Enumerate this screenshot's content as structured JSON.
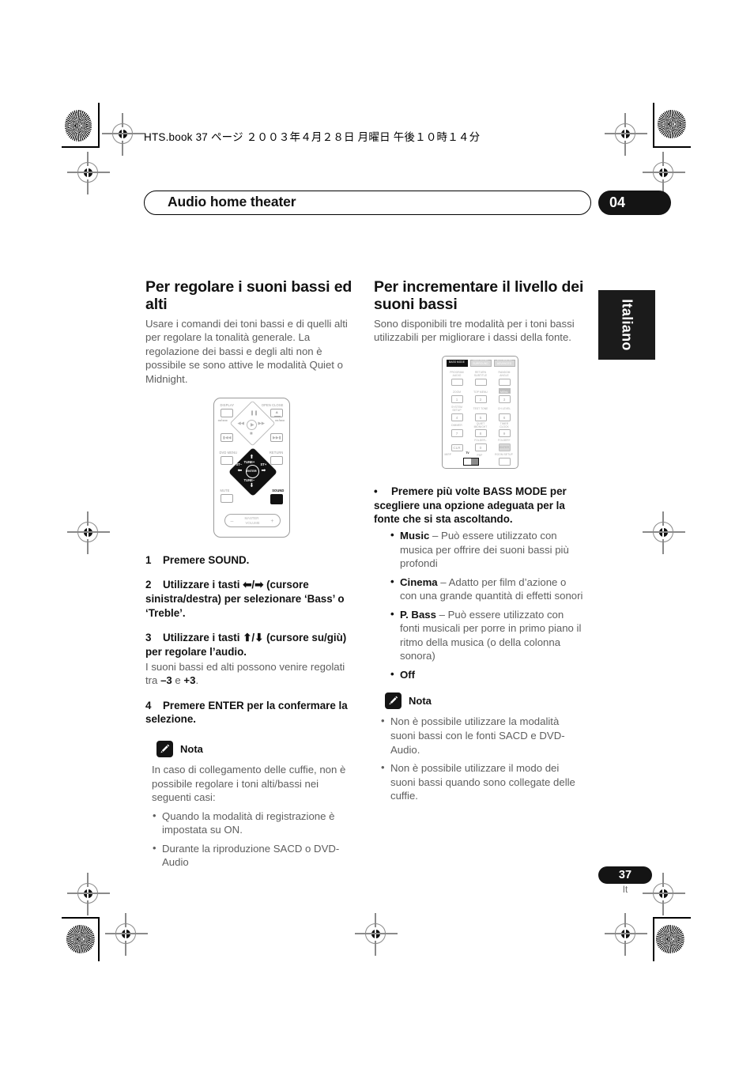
{
  "header": {
    "filestamp": "HTS.book  37 ページ  ２００３年４月２８日   月曜日   午後１０時１４分",
    "chapter_title": "Audio home theater",
    "chapter_number": "04"
  },
  "side_tab": {
    "label": "Italiano"
  },
  "left_column": {
    "heading": "Per regolare i suoni bassi ed alti",
    "intro": "Usare i comandi dei toni bassi e di quelli alti per regolare la tonalità generale. La regolazione dei bassi e degli alti non è possibile se sono attive le modalità Quiet o Midnight.",
    "steps": [
      {
        "num": "1",
        "text": "Premere SOUND."
      },
      {
        "num": "2",
        "text": "Utilizzare i tasti ⬅/➡ (cursore sinistra/destra) per selezionare ‘Bass’ o ‘Treble’."
      },
      {
        "num": "3",
        "text": "Utilizzare i tasti ⬆/⬇ (cursore su/giù) per regolare l’audio."
      },
      {
        "num": "4",
        "text": "Premere ENTER per la confermare la selezione."
      }
    ],
    "step3_note_prefix": "I suoni bassi ed alti possono venire regolati tra ",
    "step3_note_min": "–3",
    "step3_note_mid": " e ",
    "step3_note_max": "+3",
    "step3_note_suffix": ".",
    "nota_label": "Nota",
    "nota_intro": "In caso di collegamento delle cuffie, non è possibile regolare i toni alti/bassi nei seguenti casi:",
    "nota_bullets": [
      "Quando la modalità di registrazione è impostata su ON.",
      "Durante la riproduzione SACD o DVD-Audio"
    ]
  },
  "right_column": {
    "heading": "Per incrementare il livello dei suoni bassi",
    "intro": "Sono disponibili tre modalità per i toni bassi utilizzabili per migliorare i dassi della fonte.",
    "lead_bullet": "Premere più volte BASS MODE per scegliere una opzione adeguata per la fonte che si sta ascoltando.",
    "modes": [
      {
        "name": "Music",
        "desc": " – Può essere utilizzato con musica per offrire dei suoni bassi più profondi"
      },
      {
        "name": "Cinema",
        "desc": " – Adatto per film d’azione o con una grande quantità di effetti sonori"
      },
      {
        "name": "P. Bass",
        "desc": " – Può essere utilizzato con fonti musicali per porre in primo piano il ritmo della musica (o della colonna sonora)"
      },
      {
        "name": "Off",
        "desc": ""
      }
    ],
    "nota_label": "Nota",
    "nota_bullets": [
      "Non è possibile utilizzare la modalità suoni bassi con le fonti SACD e DVD-Audio.",
      "Non è possibile utilizzare il modo dei suoni bassi quando sono collegate delle cuffie."
    ]
  },
  "remote_transport": {
    "labels": {
      "display": "DISPLAY",
      "open_close": "OPEN CLOSE",
      "scan_back": "◂◂/◂◂◂",
      "scan_fwd": "▸▸/▸▸▸",
      "dvd_menu": "DVD MENU",
      "return": "RETURN",
      "mute": "MUTE",
      "sound": "SOUND",
      "tune_up": "TUNE+",
      "tune_down": "TUNE–",
      "st_minus": "ST–",
      "st_plus": "ST+",
      "enter": "ENTER",
      "master_volume_1": "MASTER",
      "master_volume_2": "VOLUME",
      "vol_minus": "–",
      "vol_plus": "+",
      "pause": "❙❙",
      "play": "▸",
      "stop": "■",
      "rew": "◂◂",
      "ff": "▸▸",
      "prev": "❘◂◂",
      "next": "▸▸❘"
    }
  },
  "remote_numeric": {
    "top_row": [
      "BASS MODE",
      "SURROUND",
      "VIRTUAL 3D"
    ],
    "top_row_sub": [
      "",
      "SURROUND",
      "ADVANCED"
    ],
    "row1": [
      "PROGRAM",
      "RETURN",
      "RANDOM"
    ],
    "row1_sub": [
      "AUDIO",
      "SUBTITLE",
      "ANGLE"
    ],
    "row2_labels": [
      "ZOOM",
      "TOP MENU",
      "MENU"
    ],
    "row2_sub": [
      "",
      "",
      "DVD"
    ],
    "row2_keys": [
      "1",
      "2",
      "3"
    ],
    "row3_labels": [
      "SYSTEM",
      "TEST TONE",
      "CH LEVEL"
    ],
    "row3_sub": [
      "SETUP",
      "",
      ""
    ],
    "row3_keys": [
      "4",
      "5",
      "6"
    ],
    "row4_labels": [
      "DIMMER",
      "QUIET",
      "TIMER"
    ],
    "row4_sub": [
      "",
      "MIDNIGHT",
      "CLOCK"
    ],
    "row4_keys": [
      "7",
      "8",
      "9"
    ],
    "row5_labels": [
      "",
      "FOLDER–",
      "FOLDER+"
    ],
    "row5_keys": [
      "CLR",
      "0",
      "ENTER"
    ],
    "bottom_labels": [
      "MIRP",
      "TV",
      "PDP",
      "ROOM SETUP"
    ],
    "highlight": "BASS MODE"
  },
  "footer": {
    "page_number": "37",
    "language_code": "It"
  },
  "colors": {
    "ink": "#111111",
    "body_gray": "#5e5e5e",
    "rule_gray": "#9a9a9a",
    "tab_black": "#1b1b1b"
  }
}
